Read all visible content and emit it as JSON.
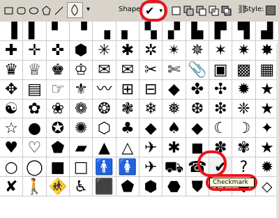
{
  "toolbar": {
    "shape_label": "Shape:",
    "style_label": "Style:",
    "mode_icons": [
      "rect-icon",
      "rounded-rect-icon",
      "ellipse-icon",
      "polygon-icon",
      "line-icon",
      "custom-shape-icon"
    ],
    "dropdown_arrow": "▾",
    "selected_shape_glyph": "✔",
    "path_ops": [
      "new-layer-icon",
      "combine-icon",
      "subtract-icon",
      "intersect-icon",
      "exclude-icon"
    ],
    "link_glyph": "⛓",
    "swatch_color": "#6a6a6a"
  },
  "shapes": {
    "rows": [
      [
        "▐",
        "▌",
        "▘",
        "▝",
        "▗",
        "▖",
        "▚",
        "▞",
        "▙",
        "▛",
        "▜",
        "▟"
      ],
      [
        "✚",
        "✛",
        "✜",
        "⬢",
        "✳",
        "✱",
        "✲",
        "✴",
        "✵",
        "✶",
        "✷",
        "✸"
      ],
      [
        "♛",
        "♕",
        "♚",
        "♔",
        "✉",
        "✉",
        "✂",
        "✄",
        "📎",
        "▣",
        "▩",
        "▦"
      ],
      [
        "✥",
        "▤",
        "☞",
        "⚜",
        "〰",
        "⊞",
        "⊟",
        "◆",
        "✤",
        "✣",
        "✹",
        "★"
      ],
      [
        "☯",
        "✿",
        "❀",
        "❁",
        "❂",
        "❃",
        "❄",
        "❅",
        "❆",
        "❇",
        "❈",
        "★"
      ],
      [
        "☆",
        "●",
        "✪",
        "✺",
        "⬡",
        "♣",
        "◆",
        "♠",
        "◆",
        "☾",
        "☽",
        "✦"
      ],
      [
        "♥",
        "♡",
        "⬟",
        "▰",
        "▲",
        "△",
        "✈",
        "✱",
        "◼",
        "✽",
        "✾",
        "★"
      ],
      [
        "○",
        "◯",
        "■",
        "□",
        "🚹",
        "🚺",
        "✈",
        "⛟",
        "☎",
        "✔",
        "?",
        "✹"
      ],
      [
        "✘",
        "🚶",
        "🚸",
        "♿",
        "⬛",
        "⬟",
        "⬢",
        "⬣",
        "⛊",
        "⛉",
        "⬥",
        "⬦"
      ]
    ],
    "selected_index": "7-9"
  },
  "tooltip_text": "Checkmark"
}
